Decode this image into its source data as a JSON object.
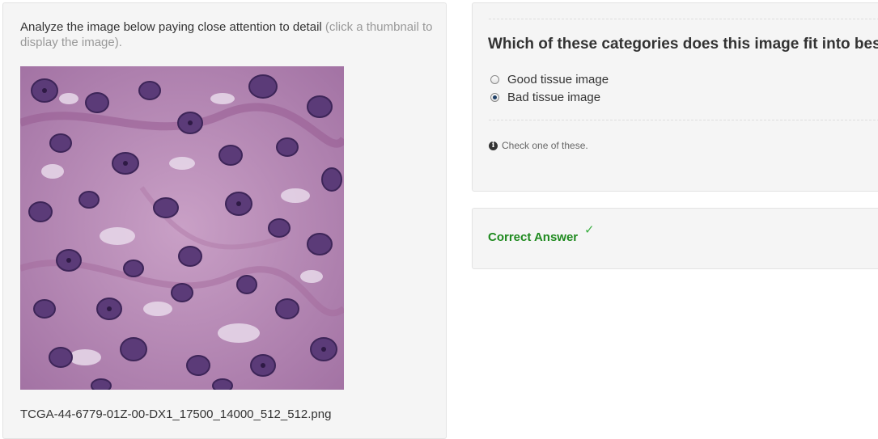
{
  "instructions": {
    "main": "Analyze the image below paying close attention to detail",
    "hint": "(click a thumbnail to display the image)."
  },
  "image": {
    "filename": "TCGA-44-6779-01Z-00-DX1_17500_14000_512_512.png",
    "icon": "tissue-image"
  },
  "question": {
    "title": "Which of these categories does this image fit into best?",
    "options": [
      {
        "label": "Good tissue image",
        "selected": false
      },
      {
        "label": "Bad tissue image",
        "selected": true
      }
    ],
    "help": "Check one of these."
  },
  "answer": {
    "text": "Correct Answer",
    "icon": "checkmark-icon"
  },
  "colors": {
    "panel_bg": "#f5f5f5",
    "correct_green": "#1f8a1f",
    "check_green": "#3cb043",
    "hint_gray": "#999999"
  }
}
